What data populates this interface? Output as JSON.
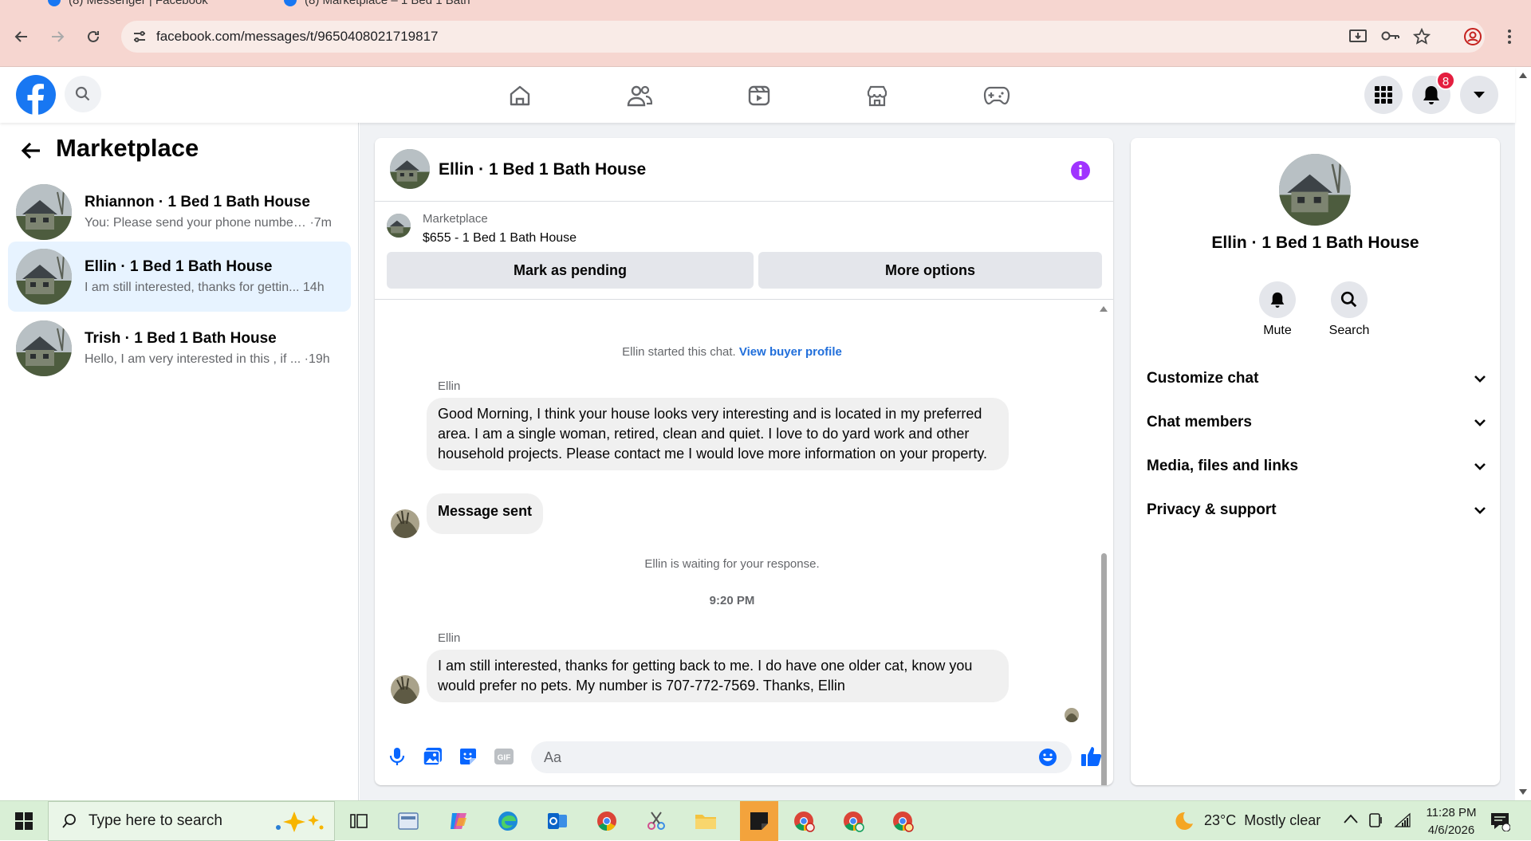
{
  "browser": {
    "tabs": [
      {
        "title": "(8) Messenger | Facebook"
      },
      {
        "title": "(8) Marketplace – 1 Bed 1 Bath"
      }
    ],
    "url": "facebook.com/messages/t/9650408021719817"
  },
  "header": {
    "notification_count": "8"
  },
  "sidebar": {
    "title": "Marketplace",
    "conversations": [
      {
        "name": "Rhiannon · 1 Bed 1 Bath House",
        "preview": "You: Please send your phone number...",
        "time": "·7m"
      },
      {
        "name": "Ellin · 1 Bed 1 Bath House",
        "preview": "I am still interested, thanks for gettin...",
        "time": "14h"
      },
      {
        "name": "Trish · 1 Bed 1 Bath House",
        "preview": "Hello, I am very interested in this , if ...",
        "time": "·19h"
      }
    ]
  },
  "chat": {
    "title": "Ellin · 1 Bed 1 Bath House",
    "listing_source": "Marketplace",
    "listing_title": "$655 - 1 Bed 1 Bath House",
    "mark_pending_label": "Mark as pending",
    "more_options_label": "More options",
    "started_text": "Ellin started this chat.",
    "view_profile_link": "View buyer profile",
    "sender1": "Ellin",
    "message1": "Good Morning, I think your house looks very interesting and is located in my preferred area. I am a single woman, retired, clean and quiet. I love to do yard work and other household projects. Please contact me I would love more information on your property.",
    "message2": "Message sent",
    "waiting_text": "Ellin is waiting for your response.",
    "timestamp": "9:20 PM",
    "sender2": "Ellin",
    "message3": "I am still interested, thanks for getting back to me. I do have one older cat, know you would prefer no pets. My number is 707-772-7569. Thanks, Ellin",
    "input_placeholder": "Aa"
  },
  "details": {
    "name": "Ellin · 1 Bed 1 Bath House",
    "mute_label": "Mute",
    "search_label": "Search",
    "sections": [
      "Customize chat",
      "Chat members",
      "Media, files and links",
      "Privacy & support"
    ]
  },
  "taskbar": {
    "search_placeholder": "Type here to search",
    "weather": "23°C  Mostly clear",
    "time": "11:28 PM",
    "date": "4/6/2026"
  },
  "colors": {
    "fb_blue": "#1877f2",
    "notification_red": "#e41e3f",
    "info_purple": "#a033ff"
  }
}
